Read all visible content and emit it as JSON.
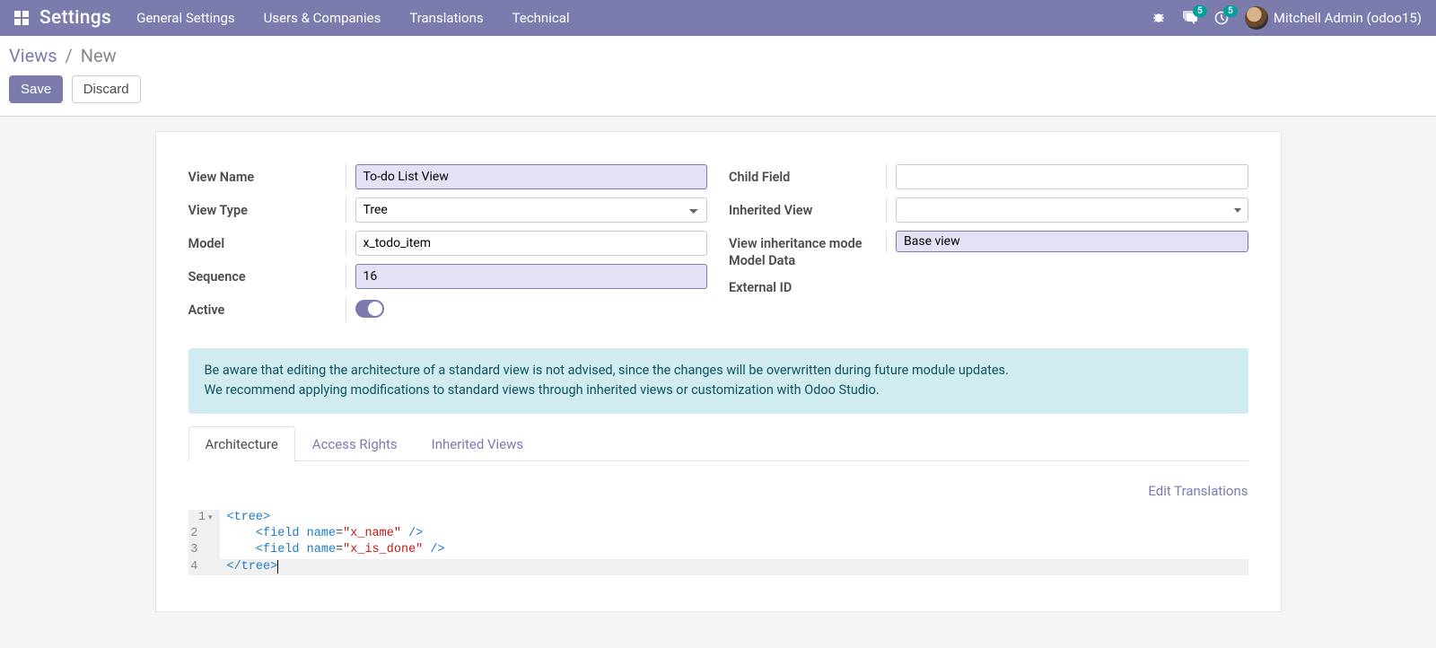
{
  "nav": {
    "brand": "Settings",
    "menu": [
      "General Settings",
      "Users & Companies",
      "Translations",
      "Technical"
    ],
    "chat_badge": "5",
    "activity_badge": "5",
    "user": "Mitchell Admin (odoo15)"
  },
  "breadcrumb": {
    "root": "Views",
    "current": "New"
  },
  "buttons": {
    "save": "Save",
    "discard": "Discard"
  },
  "labels": {
    "view_name": "View Name",
    "view_type": "View Type",
    "model": "Model",
    "sequence": "Sequence",
    "active": "Active",
    "child_field": "Child Field",
    "inherited_view": "Inherited View",
    "inheritance_mode": "View inheritance mode",
    "model_data": "Model Data",
    "external_id": "External ID"
  },
  "fields": {
    "view_name": "To-do List View",
    "view_type": "Tree",
    "model": "x_todo_item",
    "sequence": "16",
    "child_field": "",
    "inherited_view": "",
    "inheritance_mode": "Base view"
  },
  "alert": {
    "l1": "Be aware that editing the architecture of a standard view is not advised, since the changes will be overwritten during future module updates.",
    "l2": "We recommend applying modifications to standard views through inherited views or customization with Odoo Studio."
  },
  "tabs": {
    "arch": "Architecture",
    "access": "Access Rights",
    "inh": "Inherited Views"
  },
  "edit_translations": "Edit Translations",
  "code": {
    "lines": [
      "1",
      "2",
      "3",
      "4"
    ],
    "l1_tag": "tree",
    "l2_tag": "field",
    "l2_attr": "name",
    "l2_val": "\"x_name\"",
    "l3_tag": "field",
    "l3_attr": "name",
    "l3_val": "\"x_is_done\"",
    "l4_tag": "tree"
  }
}
